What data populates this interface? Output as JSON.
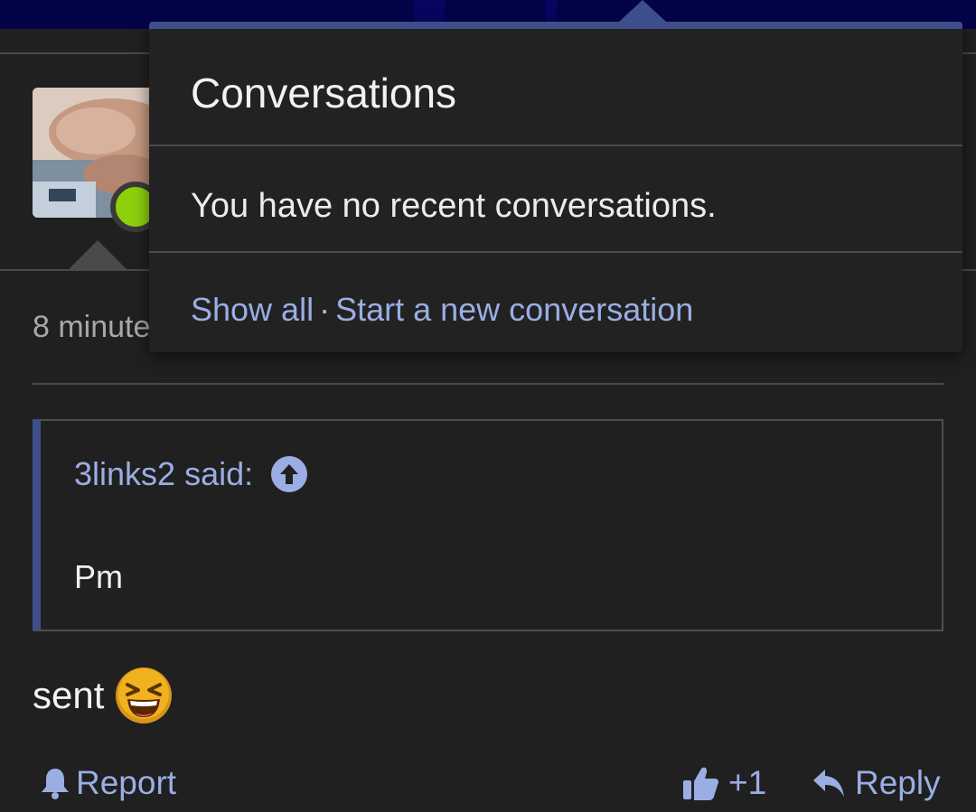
{
  "post": {
    "timestamp": "8 minute",
    "quote": {
      "author_label": "3links2 said:",
      "text": "Pm"
    },
    "message": "sent",
    "message_emoji": "laughing-squinting-face-icon",
    "actions": {
      "report": "Report",
      "like_count": "+1",
      "reply": "Reply"
    }
  },
  "conversations_popup": {
    "title": "Conversations",
    "empty_text": "You have no recent conversations.",
    "show_all": "Show all",
    "separator": "·",
    "start_new": "Start a new conversation"
  },
  "colors": {
    "background": "#202020",
    "topbar": "#03034a",
    "link": "#9aaee4",
    "accent": "#3d4f8a",
    "online": "#8fd00c"
  },
  "icons": [
    "online-status-icon",
    "arrow-up-circle-icon",
    "bell-icon",
    "thumbs-up-icon",
    "reply-arrow-icon"
  ]
}
